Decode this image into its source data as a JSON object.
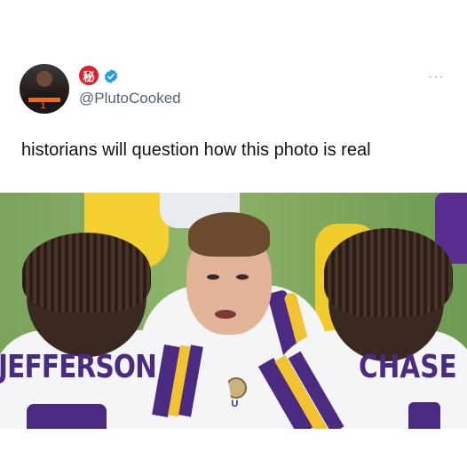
{
  "tweet": {
    "handle": "@PlutoCooked",
    "badge_glyph": "秘",
    "more_label": "···",
    "text": "historians will question how this photo is real",
    "avatar_jersey_number": "1"
  },
  "photo": {
    "left_jersey_name": "JEFFERSON",
    "right_jersey_name": "CHASE",
    "chest_logo_text": "SU"
  },
  "colors": {
    "handle_gray": "#536471",
    "verified_blue": "#1d9bf0",
    "badge_red": "#e0202a",
    "lsu_purple": "#4b2a82",
    "lsu_gold": "#f2c230"
  },
  "icons": [
    "verified-badge-icon",
    "secret-badge-icon",
    "more-options-icon"
  ]
}
